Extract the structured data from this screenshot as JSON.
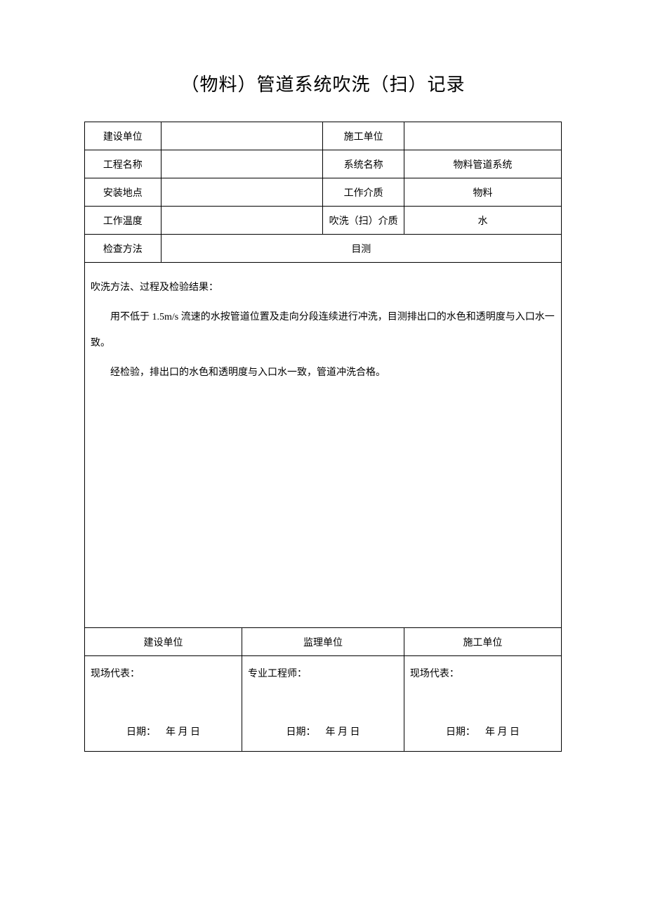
{
  "title": "（物料）管道系统吹洗（扫）记录",
  "info": {
    "row1": {
      "l1": "建设单位",
      "v1": "",
      "l2": "施工单位",
      "v2": ""
    },
    "row2": {
      "l1": "工程名称",
      "v1": "",
      "l2": "系统名称",
      "v2": "物料管道系统"
    },
    "row3": {
      "l1": "安装地点",
      "v1": "",
      "l2": "工作介质",
      "v2": "物料"
    },
    "row4": {
      "l1": "工作温度",
      "v1": "",
      "l2": "吹洗（扫）介质",
      "v2": "水"
    },
    "row5": {
      "l1": "检查方法",
      "v1": "目测"
    }
  },
  "method": {
    "heading": "吹洗方法、过程及检验结果：",
    "body1": "用不低于 1.5m/s 流速的水按管道位置及走向分段连续进行冲洗，目测排出口的水色和透明度与入口水一致。",
    "body2": "经检验，排出口的水色和透明度与入口水一致，管道冲洗合格。"
  },
  "footer": {
    "h1": "建设单位",
    "h2": "监理单位",
    "h3": "施工单位",
    "sign1": "现场代表：",
    "sign2": "专业工程师：",
    "sign3": "现场代表：",
    "date_label": "日期：",
    "date_value": "年 月 日"
  }
}
